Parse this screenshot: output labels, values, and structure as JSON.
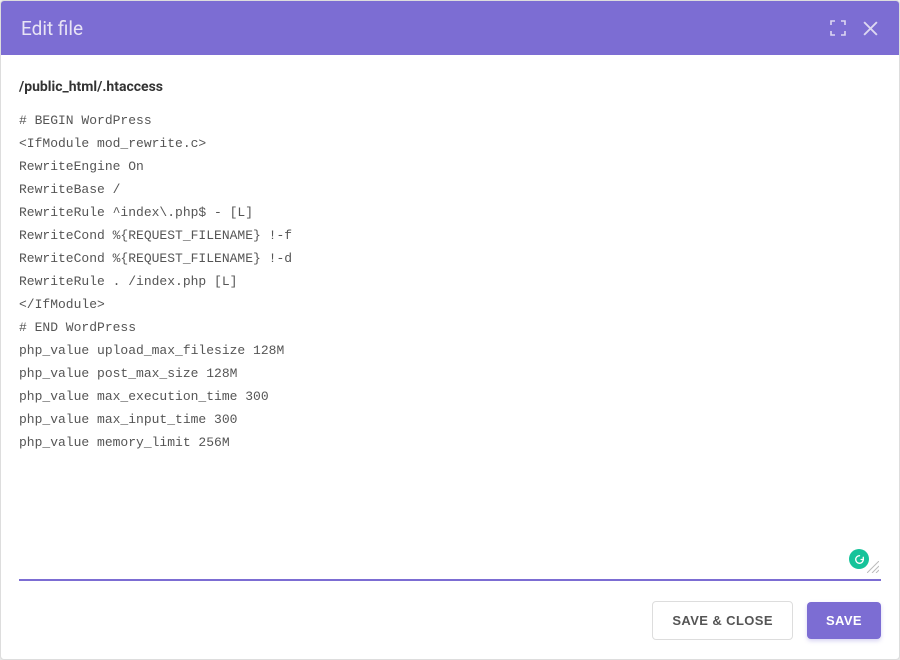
{
  "header": {
    "title": "Edit file"
  },
  "file": {
    "path": "/public_html/.htaccess",
    "content": "# BEGIN WordPress\n<IfModule mod_rewrite.c>\nRewriteEngine On\nRewriteBase /\nRewriteRule ^index\\.php$ - [L]\nRewriteCond %{REQUEST_FILENAME} !-f\nRewriteCond %{REQUEST_FILENAME} !-d\nRewriteRule . /index.php [L]\n</IfModule>\n# END WordPress\nphp_value upload_max_filesize 128M\nphp_value post_max_size 128M\nphp_value max_execution_time 300\nphp_value max_input_time 300\nphp_value memory_limit 256M"
  },
  "footer": {
    "save_close_label": "SAVE & CLOSE",
    "save_label": "SAVE"
  },
  "icons": {
    "expand": "expand-icon",
    "close": "close-icon",
    "grammarly": "grammarly-icon"
  },
  "colors": {
    "primary": "#7c6dd3",
    "grammarly": "#15c39a"
  }
}
